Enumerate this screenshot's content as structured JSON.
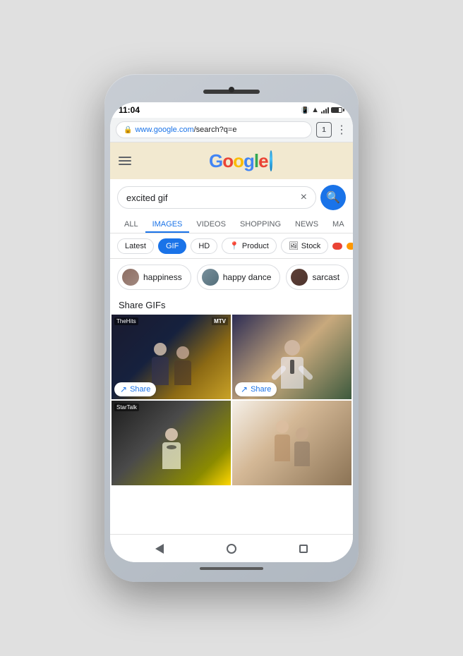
{
  "phone": {
    "status_bar": {
      "time": "11:04",
      "notification_dot": "•"
    },
    "address_bar": {
      "protocol": "https://",
      "url_blue": "www.google.com",
      "url_rest": "/search?q=e",
      "tab_count": "1"
    },
    "search": {
      "query": "excited gif",
      "clear_label": "×",
      "search_button_icon": "🔍"
    },
    "tabs": [
      {
        "label": "ALL",
        "active": false
      },
      {
        "label": "IMAGES",
        "active": true
      },
      {
        "label": "VIDEOS",
        "active": false
      },
      {
        "label": "SHOPPING",
        "active": false
      },
      {
        "label": "NEWS",
        "active": false
      },
      {
        "label": "MA",
        "active": false
      }
    ],
    "filters": [
      {
        "label": "Latest",
        "selected": false
      },
      {
        "label": "GIF",
        "selected": true
      },
      {
        "label": "HD",
        "selected": false
      },
      {
        "label": "Product",
        "selected": false,
        "icon": "📍"
      },
      {
        "label": "Stock",
        "selected": false,
        "icon": "🖼"
      }
    ],
    "suggestions": [
      {
        "label": "happiness"
      },
      {
        "label": "happy dance"
      },
      {
        "label": "sarcast"
      }
    ],
    "section_label": "Share GIFs",
    "gifs": [
      {
        "watermark": "TheHits",
        "share_label": "Share",
        "id": "gif-1"
      },
      {
        "watermark": "",
        "share_label": "Share",
        "id": "gif-2"
      },
      {
        "watermark": "StarTalk",
        "share_label": "",
        "id": "gif-3"
      },
      {
        "watermark": "",
        "share_label": "",
        "id": "gif-4"
      }
    ],
    "share_label": "Share"
  }
}
